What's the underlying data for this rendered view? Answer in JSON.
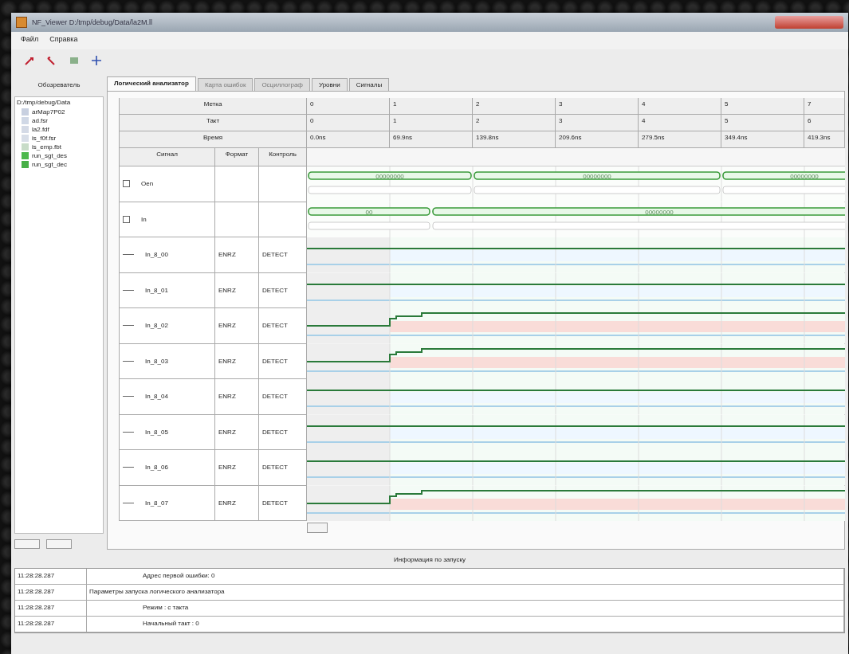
{
  "window": {
    "title": "NF_Viewer D:/tmp/debug/Data/la2M.ll"
  },
  "menu": [
    "Файл",
    "Справка"
  ],
  "sidebar": {
    "title": "Обозреватель",
    "path": "D:/tmp/debug/Data",
    "items": [
      {
        "label": "arMap7P02",
        "color": "#c8d0e0"
      },
      {
        "label": "ad.fsr",
        "color": "#d0d8e6"
      },
      {
        "label": "la2.fdf",
        "color": "#d4dae6"
      },
      {
        "label": "is_f0f.fsr",
        "color": "#d8dee8"
      },
      {
        "label": "is_emp.fbt",
        "color": "#c8dcc8"
      },
      {
        "label": "run_sgt_des",
        "color": "#4cb84c"
      },
      {
        "label": "run_sgt_dec",
        "color": "#48b048"
      }
    ]
  },
  "tabs": [
    {
      "label": "Логический анализатор",
      "selected": true,
      "disabled": false
    },
    {
      "label": "Карта ошибок",
      "selected": false,
      "disabled": true
    },
    {
      "label": "Осциллограф",
      "selected": false,
      "disabled": true
    },
    {
      "label": "Уровни",
      "selected": false,
      "disabled": false
    },
    {
      "label": "Сигналы",
      "selected": false,
      "disabled": false
    }
  ],
  "header_rows": [
    {
      "label": "Метка",
      "cells": [
        "0",
        "1",
        "2",
        "3",
        "4",
        "5",
        "7"
      ]
    },
    {
      "label": "Такт",
      "cells": [
        "0",
        "1",
        "2",
        "3",
        "4",
        "5",
        "6"
      ]
    },
    {
      "label": "Время",
      "cells": [
        "0.0ns",
        "69.9ns",
        "139.8ns",
        "209.6ns",
        "279.5ns",
        "349.4ns",
        "419.3ns"
      ]
    }
  ],
  "columns": [
    "Сигнал",
    "Формат",
    "Контроль"
  ],
  "signals": [
    {
      "kind": "bus",
      "name": "Oen",
      "segments": [
        {
          "label": "00000000"
        },
        {
          "label": "00000000"
        },
        {
          "label": "00000000"
        }
      ]
    },
    {
      "kind": "bus",
      "name": "In",
      "segments": [
        {
          "label": "00"
        },
        {
          "label": "00000000"
        }
      ]
    },
    {
      "kind": "bit",
      "name": "In_8_00",
      "format": "ENRZ",
      "control": "DETECT",
      "rises": false
    },
    {
      "kind": "bit",
      "name": "In_8_01",
      "format": "ENRZ",
      "control": "DETECT",
      "rises": false
    },
    {
      "kind": "bit",
      "name": "In_8_02",
      "format": "ENRZ",
      "control": "DETECT",
      "rises": true
    },
    {
      "kind": "bit",
      "name": "In_8_03",
      "format": "ENRZ",
      "control": "DETECT",
      "rises": true
    },
    {
      "kind": "bit",
      "name": "In_8_04",
      "format": "ENRZ",
      "control": "DETECT",
      "rises": false
    },
    {
      "kind": "bit",
      "name": "In_8_05",
      "format": "ENRZ",
      "control": "DETECT",
      "rises": false
    },
    {
      "kind": "bit",
      "name": "In_8_06",
      "format": "ENRZ",
      "control": "DETECT",
      "rises": false
    },
    {
      "kind": "bit",
      "name": "In_8_07",
      "format": "ENRZ",
      "control": "DETECT",
      "rises": true
    }
  ],
  "log": {
    "title": "Информация по запуску",
    "rows": [
      {
        "time": "11:28:28.287",
        "message": "Адрес первой ошибки: 0",
        "indent": true
      },
      {
        "time": "11:28:28.287",
        "message": "Параметры запуска логического анализатора",
        "indent": false
      },
      {
        "time": "11:28:28.287",
        "message": "Режим : с такта",
        "indent": true
      },
      {
        "time": "11:28:28.287",
        "message": "Начальный такт : 0",
        "indent": true
      }
    ]
  }
}
